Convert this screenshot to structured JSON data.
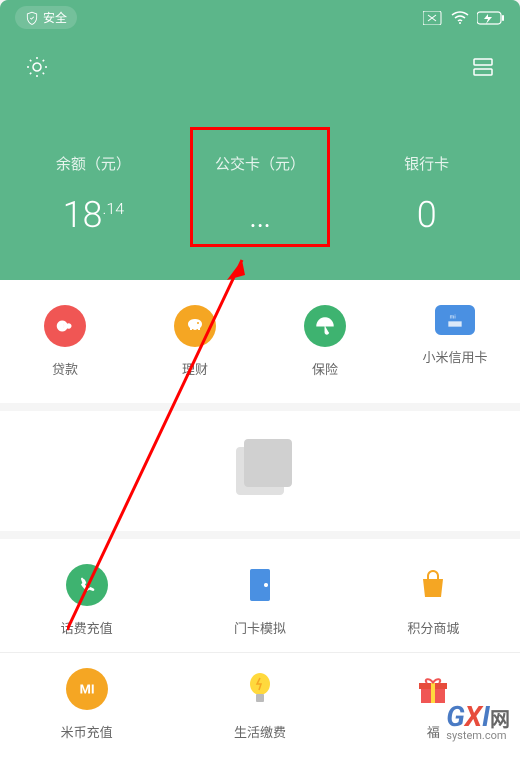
{
  "status": {
    "safe_label": "安全"
  },
  "balances": {
    "wallet": {
      "label": "余额（元）",
      "value_int": "18",
      "value_dec": ".14"
    },
    "transit": {
      "label": "公交卡（元）",
      "value": "…"
    },
    "bank": {
      "label": "银行卡",
      "value": "0"
    }
  },
  "grid1": {
    "loan": "贷款",
    "finance": "理财",
    "insurance": "保险",
    "credit_card": "小米信用卡"
  },
  "grid2": {
    "phone_recharge": "话费充值",
    "door_card": "门卡模拟",
    "points_mall": "积分商城",
    "mi_coin": "米币充值",
    "life_payment": "生活缴费",
    "welfare": "福"
  },
  "watermark": {
    "text_g": "G",
    "text_x": "X",
    "text_i": "I",
    "text_suffix": "网",
    "sub": "system.com"
  },
  "colors": {
    "primary": "#5cb68a",
    "red": "#f05654",
    "orange": "#f5a623",
    "green": "#3eb370",
    "blue": "#4a90e2"
  }
}
